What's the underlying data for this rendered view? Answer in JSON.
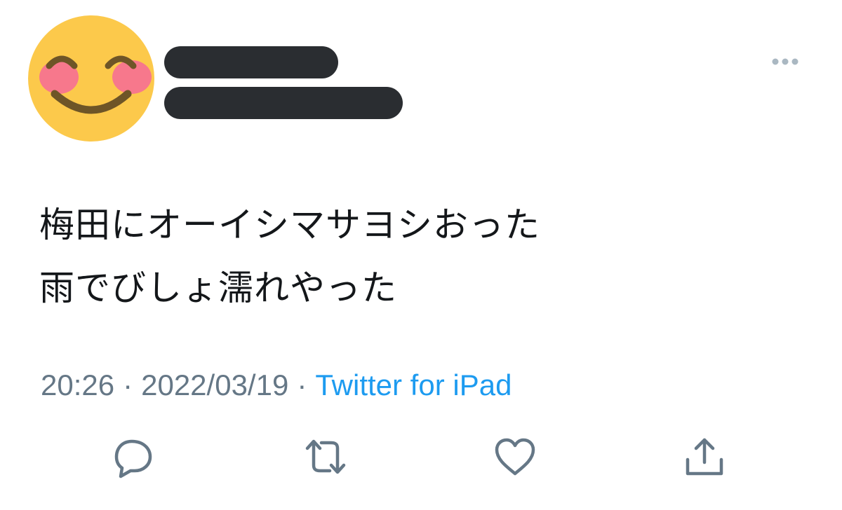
{
  "tweet": {
    "author": {
      "avatar_icon": "smiling-face-with-blush-icon"
    },
    "text_lines": [
      "梅田にオーイシマサヨシおった",
      "雨でびしょ濡れやった"
    ],
    "time": "20:26",
    "separator": "·",
    "date": "2022/03/19",
    "source": "Twitter for iPad"
  },
  "actions": {
    "reply_icon": "reply-icon",
    "retweet_icon": "retweet-icon",
    "like_icon": "heart-icon",
    "share_icon": "share-icon",
    "more_icon": "more-dots-icon"
  },
  "colors": {
    "text": "#14171a",
    "meta": "#657786",
    "link": "#1d9bf0",
    "icon": "#657786",
    "redaction": "#2a2d31"
  }
}
